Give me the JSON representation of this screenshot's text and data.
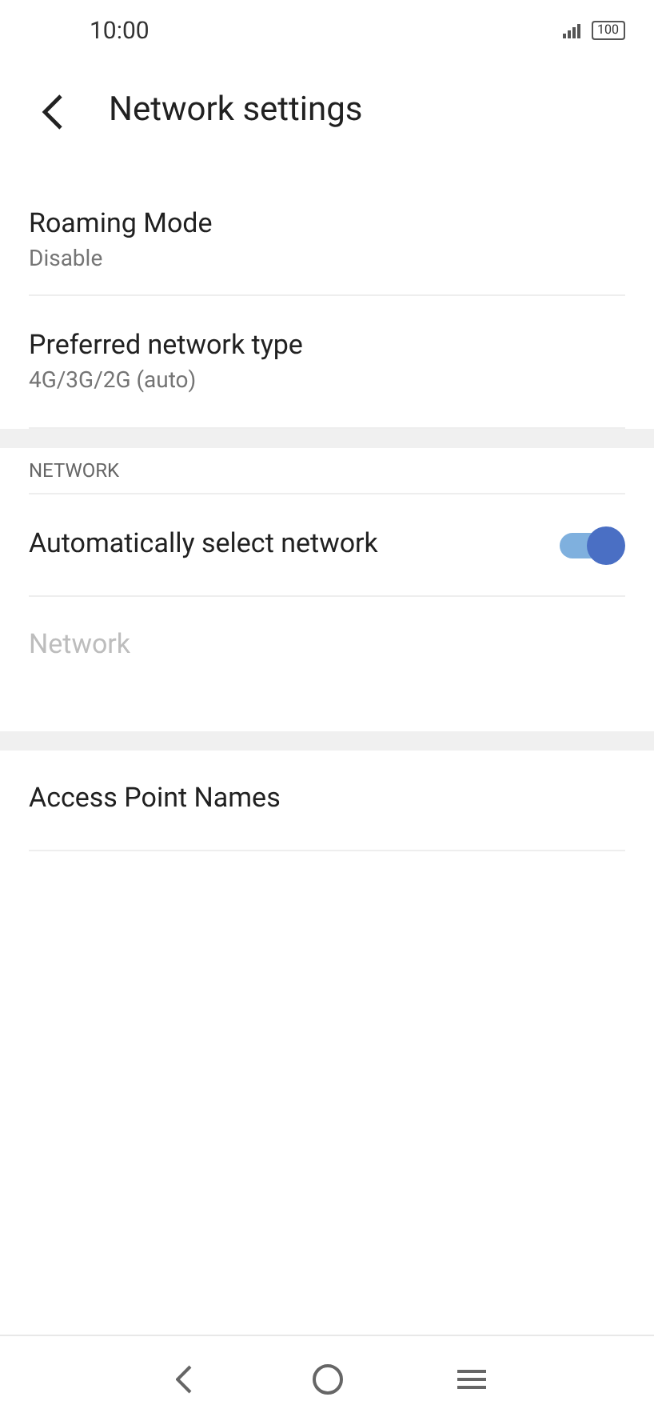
{
  "status_bar": {
    "time": "10:00",
    "battery": "100"
  },
  "header": {
    "title": "Network settings"
  },
  "sections": [
    {
      "items": [
        {
          "kind": "two_line",
          "title": "Roaming Mode",
          "subtitle": "Disable",
          "disabled": false
        },
        {
          "kind": "two_line",
          "title": "Preferred network type",
          "subtitle": "4G/3G/2G (auto)",
          "disabled": false
        }
      ]
    },
    {
      "heading": "NETWORK",
      "items": [
        {
          "kind": "toggle",
          "title": "Automatically select network",
          "on": true,
          "disabled": false
        },
        {
          "kind": "single",
          "title": "Network",
          "disabled": true
        }
      ]
    },
    {
      "items": [
        {
          "kind": "single",
          "title": "Access Point Names",
          "disabled": false
        }
      ]
    }
  ]
}
